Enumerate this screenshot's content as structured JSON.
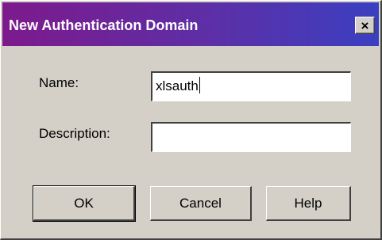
{
  "dialog": {
    "title": "New Authentication Domain",
    "close_glyph": "×"
  },
  "form": {
    "name_label": "Name:",
    "name_value": "xlsauth",
    "description_label": "Description:",
    "description_value": ""
  },
  "buttons": {
    "ok_label": "OK",
    "cancel_label": "Cancel",
    "help_label": "Help"
  },
  "colors": {
    "titlebar_start": "#7d1a8c",
    "titlebar_end": "#3b3fc1",
    "dialog_bg": "#d4d0c8"
  }
}
